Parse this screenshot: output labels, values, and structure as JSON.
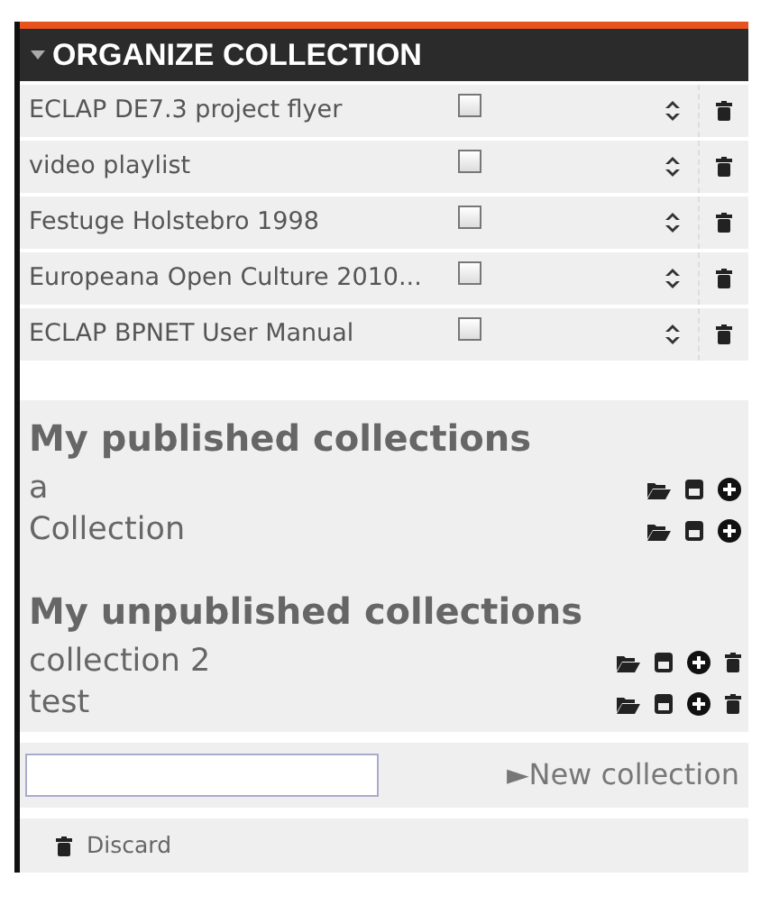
{
  "header": {
    "title": "ORGANIZE COLLECTION",
    "expanded": true
  },
  "items": [
    {
      "title": "ECLAP DE7.3 project flyer",
      "checked": false
    },
    {
      "title": "video playlist",
      "checked": false
    },
    {
      "title": "Festuge Holstebro 1998",
      "checked": false
    },
    {
      "title": "Europeana Open Culture 2010...",
      "checked": false
    },
    {
      "title": "ECLAP BPNET User Manual",
      "checked": false
    }
  ],
  "sections": [
    {
      "heading": "My published collections",
      "deletable": false,
      "collections": [
        {
          "name": "a"
        },
        {
          "name": "Collection"
        }
      ]
    },
    {
      "heading": "My unpublished collections",
      "deletable": true,
      "collections": [
        {
          "name": "collection 2"
        },
        {
          "name": "test"
        }
      ]
    }
  ],
  "new_collection": {
    "label": "►New collection"
  },
  "discard": {
    "label": "Discard"
  }
}
